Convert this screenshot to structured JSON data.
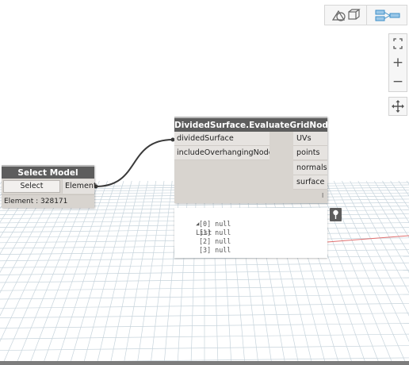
{
  "colors": {
    "node_header": "#5d5d5d",
    "node_body": "#d8d4cf",
    "grid_line": "#c7d4dc",
    "wire": "#3a3a3a",
    "axis_red": "#e07070"
  },
  "view_toggle": {
    "geometry_icon": "geometry-view-icon",
    "graph_icon": "graph-view-icon"
  },
  "zoom_toolbar": {
    "fit_icon": "zoom-to-fit-icon",
    "zoom_in_label": "+",
    "zoom_out_label": "−",
    "pan_icon": "pan-icon"
  },
  "select_node": {
    "title": "Select Model Element",
    "button_label": "Select",
    "output_port": "Element",
    "status": "Element : 328171"
  },
  "eval_node": {
    "title": "DividedSurface.EvaluateGridNodes",
    "inputs": [
      "dividedSurface",
      "includeOverhangingNodes"
    ],
    "outputs": [
      "UVs",
      "points",
      "normals",
      "surface"
    ],
    "lacing_marker": "l"
  },
  "preview": {
    "header": "List",
    "items": [
      "[0] null",
      "[1] null",
      "[2] null",
      "[3] null"
    ],
    "pin_icon": "pin-icon"
  }
}
